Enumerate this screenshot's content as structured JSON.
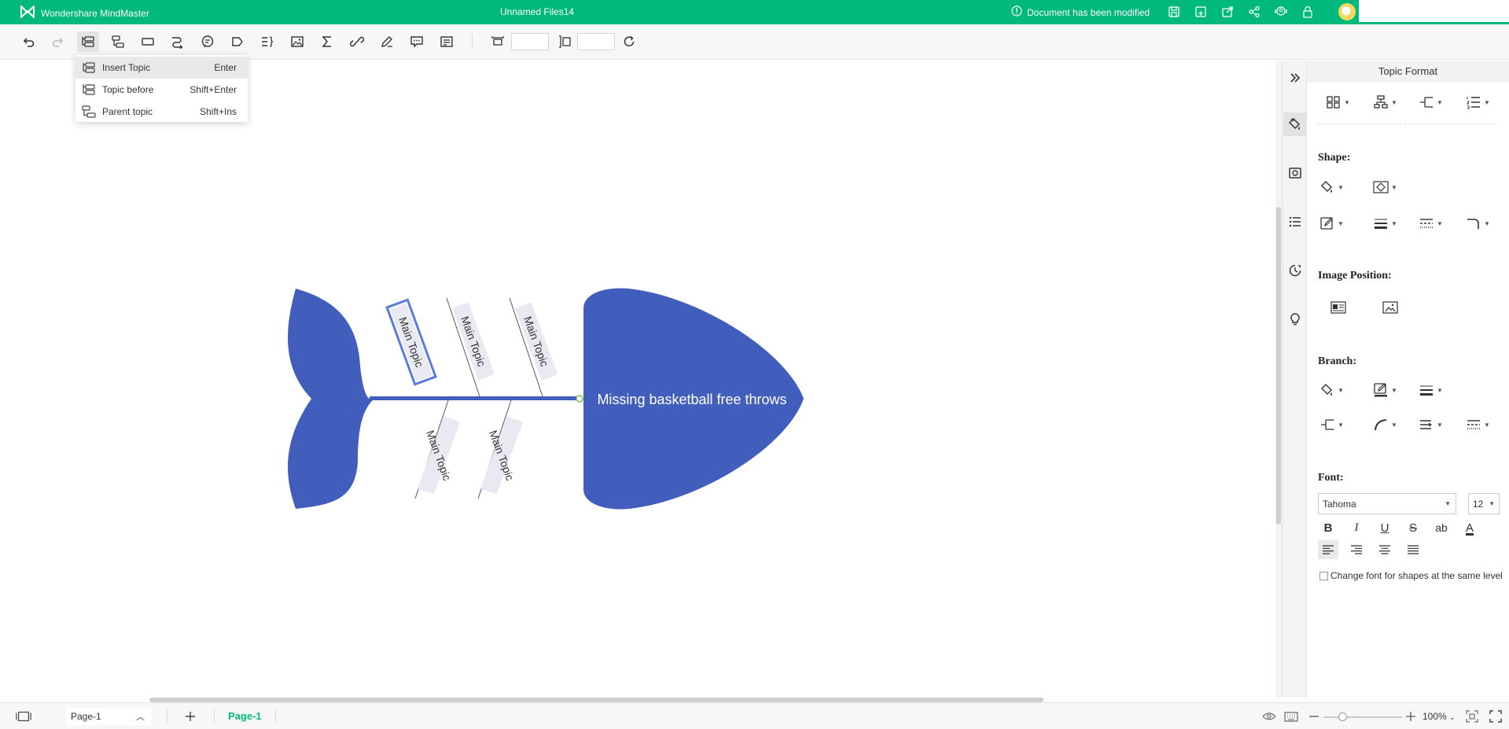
{
  "app": {
    "brand": "Wondershare MindMaster",
    "document_title": "Unnamed Files14",
    "modified_notice": "Document has been modified"
  },
  "toolbar": {
    "width_value": "",
    "height_value": ""
  },
  "insert_menu": {
    "items": [
      {
        "label": "Insert Topic",
        "shortcut": "Enter"
      },
      {
        "label": "Topic before",
        "shortcut": "Shift+Enter"
      },
      {
        "label": "Parent topic",
        "shortcut": "Shift+Ins"
      }
    ]
  },
  "diagram": {
    "head_label": "Missing basketball free throws",
    "upper_topics": [
      "Main Topic",
      "Main Topic",
      "Main Topic"
    ],
    "lower_topics": [
      "Main Topic",
      "Main Topic"
    ],
    "fish_color": "#425ebd",
    "selected_color": "#5b7be0"
  },
  "panel": {
    "title": "Topic Format",
    "shape_label": "Shape:",
    "image_position_label": "Image Position:",
    "branch_label": "Branch:",
    "font_label": "Font:",
    "font_family": "Tahoma",
    "font_size": "12",
    "format_buttons": [
      "B",
      "I",
      "U",
      "S",
      "ab",
      "A"
    ],
    "same_level_checkbox": "Change font for shapes at the same level"
  },
  "statusbar": {
    "page_select": "Page-1",
    "active_page_tab": "Page-1",
    "zoom": "100%"
  },
  "colors": {
    "accent": "#00b97a"
  }
}
